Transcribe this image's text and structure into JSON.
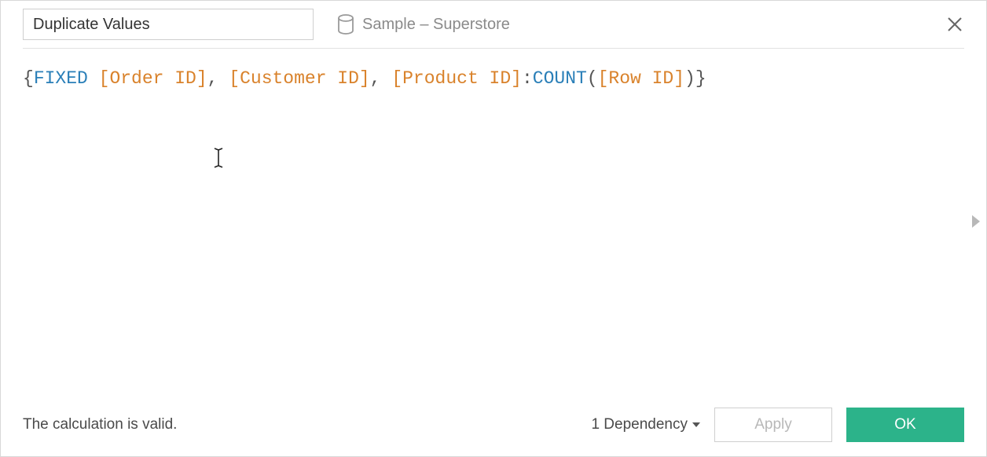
{
  "header": {
    "calc_name": "Duplicate Values",
    "datasource_label": "Sample – Superstore"
  },
  "formula": {
    "open_brace": "{",
    "keyword": "FIXED",
    "sp": " ",
    "field1": "[Order ID]",
    "comma": ", ",
    "field2": "[Customer ID]",
    "field3": "[Product ID]",
    "colon": ":",
    "func": "COUNT",
    "lparen": "(",
    "field4": "[Row ID]",
    "rparen": ")",
    "close_brace": "}"
  },
  "footer": {
    "status": "The calculation is valid.",
    "dependencies_label": "1 Dependency",
    "apply_label": "Apply",
    "ok_label": "OK"
  }
}
